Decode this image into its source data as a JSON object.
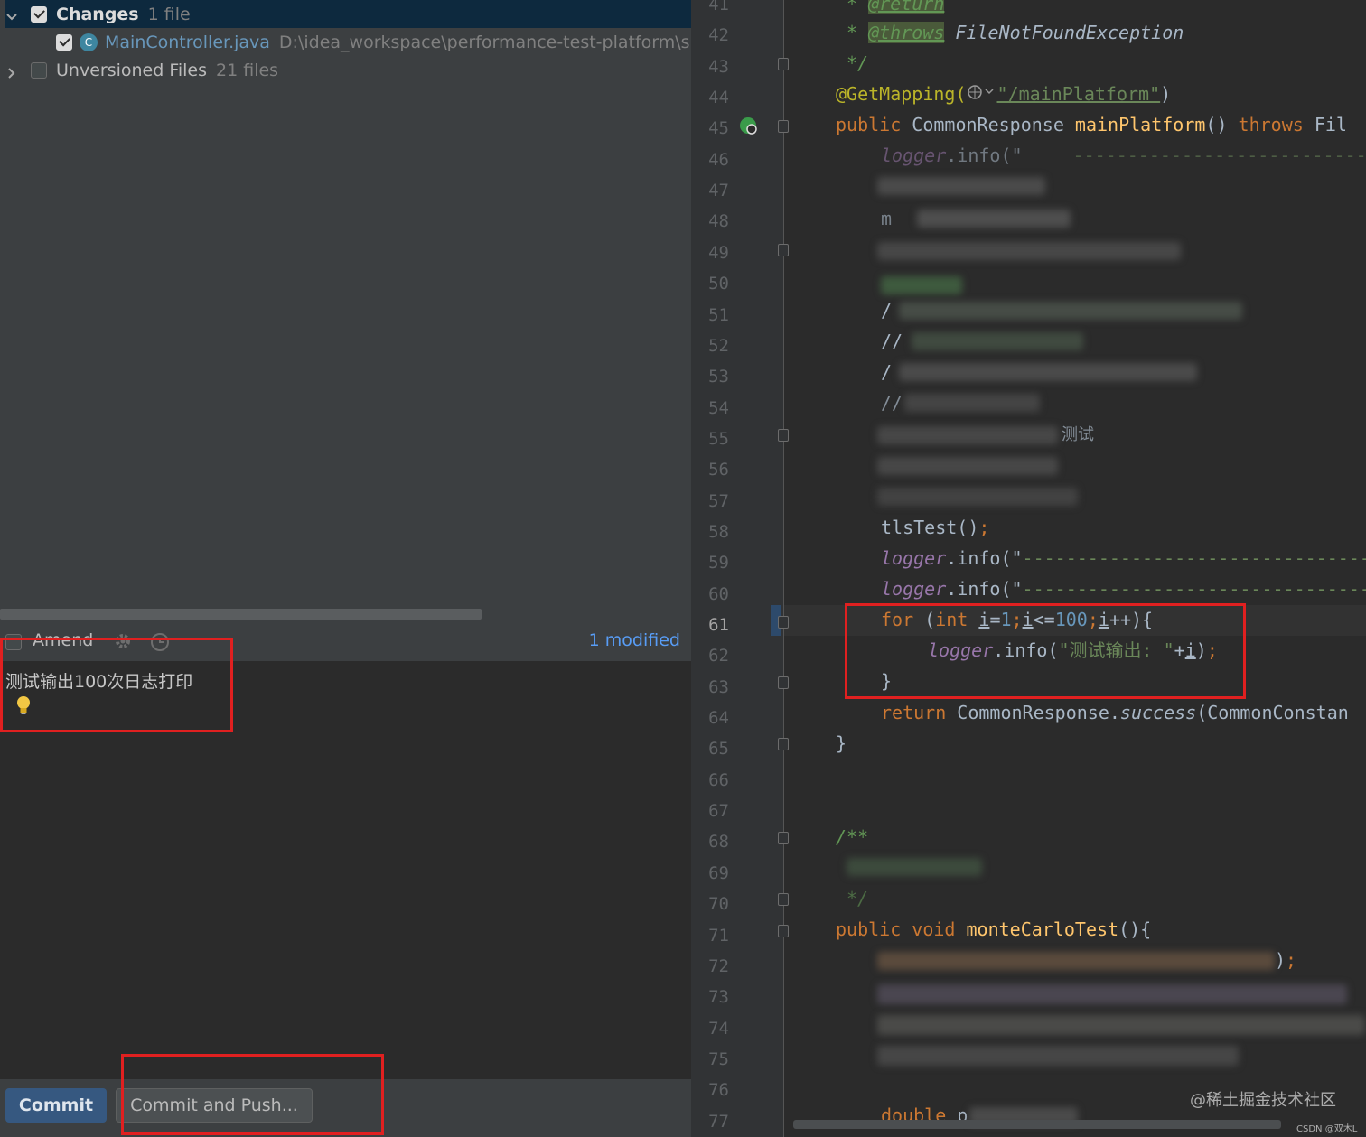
{
  "changes_panel": {
    "changes_group": {
      "label": "Changes",
      "count": "1 file",
      "checked": true
    },
    "file": {
      "name": "MainController.java",
      "path": "D:\\idea_workspace\\performance-test-platform\\src\\m",
      "icon": "class-c-icon",
      "checked": true
    },
    "unversioned_group": {
      "label": "Unversioned Files",
      "count": "21 files",
      "checked": false
    }
  },
  "commit_options": {
    "amend_label": "Amend",
    "modified_link": "1 modified"
  },
  "commit_message": {
    "text": "测试输出100次日志打印"
  },
  "buttons": {
    "commit_label": "Commit",
    "commit_push_label": "Commit and Push..."
  },
  "editor": {
    "line_numbers": [
      "41",
      "42",
      "43",
      "44",
      "45",
      "46",
      "47",
      "48",
      "49",
      "50",
      "51",
      "52",
      "53",
      "54",
      "55",
      "56",
      "57",
      "58",
      "59",
      "60",
      "61",
      "62",
      "63",
      "64",
      "65",
      "66",
      "67",
      "68",
      "69",
      "70",
      "71",
      "72",
      "73",
      "74",
      "75",
      "76",
      "77"
    ],
    "current_line": "61",
    "lines": {
      "l41": {
        "star": "* ",
        "tag": "@return"
      },
      "l42": {
        "star": "* ",
        "tag": "@throws",
        "rest": " FileNotFoundException"
      },
      "l43": {
        "text": "*/"
      },
      "l44": {
        "ann": "@GetMapping(",
        "str": "\"/mainPlatform\"",
        "close": ")"
      },
      "l45": {
        "kw1": "public ",
        "type": "CommonResponse ",
        "fn": "mainPlatform",
        "paren": "() ",
        "kw2": "throws ",
        "rest": "Fil"
      },
      "l46": {
        "field": "logger",
        "rest": ".info(\"",
        "dashes": "------------------------------"
      },
      "l48": {
        "text": "m"
      },
      "l51": {
        "text": "/"
      },
      "l52": {
        "text": "//"
      },
      "l53": {
        "text": "/"
      },
      "l54": {
        "text": "//"
      },
      "l55": {
        "text": "测试"
      },
      "l58": {
        "text": "tlsTest()",
        "semi": ";"
      },
      "l59": {
        "field": "logger",
        "rest": ".info(\"",
        "dashes": "--------------------------------"
      },
      "l60": {
        "field": "logger",
        "rest": ".info(\"",
        "dashes": "--------------------------------"
      },
      "l61": {
        "for": "for ",
        "open": "(",
        "int": "int ",
        "i1": "i",
        "eq": "=",
        "n1": "1",
        "s1": ";",
        "i2": "i",
        "le": "<=",
        "n2": "100",
        "s2": ";",
        "i3": "i",
        "inc": "++){"
      },
      "l62": {
        "field": "logger",
        "rest": ".info(",
        "str": "\"测试输出: \"",
        "plus": "+",
        "i": "i",
        "close": ")",
        "semi": ";"
      },
      "l63": {
        "text": "}"
      },
      "l64": {
        "kw": "return ",
        "type": "CommonResponse.",
        "method": "success",
        "rest": "(CommonConstan"
      },
      "l65": {
        "text": "}"
      },
      "l68": {
        "text": "/**"
      },
      "l70": {
        "text": "*/"
      },
      "l71": {
        "kw1": "public ",
        "kw2": "void ",
        "fn": "monteCarloTest",
        "rest": "(){"
      },
      "l72": {
        "close": ")",
        "semi": ";"
      },
      "l77": {
        "kw": "double ",
        "rest": "p"
      }
    }
  },
  "watermark": {
    "main": "@稀土掘金技术社区",
    "small": "CSDN @双木L"
  }
}
